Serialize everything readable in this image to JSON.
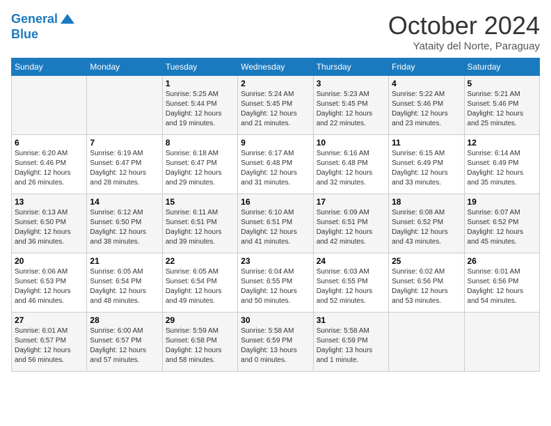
{
  "header": {
    "logo_line1": "General",
    "logo_line2": "Blue",
    "month_year": "October 2024",
    "location": "Yataity del Norte, Paraguay"
  },
  "weekdays": [
    "Sunday",
    "Monday",
    "Tuesday",
    "Wednesday",
    "Thursday",
    "Friday",
    "Saturday"
  ],
  "weeks": [
    [
      {
        "day": "",
        "content": ""
      },
      {
        "day": "",
        "content": ""
      },
      {
        "day": "1",
        "content": "Sunrise: 5:25 AM\nSunset: 5:44 PM\nDaylight: 12 hours\nand 19 minutes."
      },
      {
        "day": "2",
        "content": "Sunrise: 5:24 AM\nSunset: 5:45 PM\nDaylight: 12 hours\nand 21 minutes."
      },
      {
        "day": "3",
        "content": "Sunrise: 5:23 AM\nSunset: 5:45 PM\nDaylight: 12 hours\nand 22 minutes."
      },
      {
        "day": "4",
        "content": "Sunrise: 5:22 AM\nSunset: 5:46 PM\nDaylight: 12 hours\nand 23 minutes."
      },
      {
        "day": "5",
        "content": "Sunrise: 5:21 AM\nSunset: 5:46 PM\nDaylight: 12 hours\nand 25 minutes."
      }
    ],
    [
      {
        "day": "6",
        "content": "Sunrise: 6:20 AM\nSunset: 6:46 PM\nDaylight: 12 hours\nand 26 minutes."
      },
      {
        "day": "7",
        "content": "Sunrise: 6:19 AM\nSunset: 6:47 PM\nDaylight: 12 hours\nand 28 minutes."
      },
      {
        "day": "8",
        "content": "Sunrise: 6:18 AM\nSunset: 6:47 PM\nDaylight: 12 hours\nand 29 minutes."
      },
      {
        "day": "9",
        "content": "Sunrise: 6:17 AM\nSunset: 6:48 PM\nDaylight: 12 hours\nand 31 minutes."
      },
      {
        "day": "10",
        "content": "Sunrise: 6:16 AM\nSunset: 6:48 PM\nDaylight: 12 hours\nand 32 minutes."
      },
      {
        "day": "11",
        "content": "Sunrise: 6:15 AM\nSunset: 6:49 PM\nDaylight: 12 hours\nand 33 minutes."
      },
      {
        "day": "12",
        "content": "Sunrise: 6:14 AM\nSunset: 6:49 PM\nDaylight: 12 hours\nand 35 minutes."
      }
    ],
    [
      {
        "day": "13",
        "content": "Sunrise: 6:13 AM\nSunset: 6:50 PM\nDaylight: 12 hours\nand 36 minutes."
      },
      {
        "day": "14",
        "content": "Sunrise: 6:12 AM\nSunset: 6:50 PM\nDaylight: 12 hours\nand 38 minutes."
      },
      {
        "day": "15",
        "content": "Sunrise: 6:11 AM\nSunset: 6:51 PM\nDaylight: 12 hours\nand 39 minutes."
      },
      {
        "day": "16",
        "content": "Sunrise: 6:10 AM\nSunset: 6:51 PM\nDaylight: 12 hours\nand 41 minutes."
      },
      {
        "day": "17",
        "content": "Sunrise: 6:09 AM\nSunset: 6:51 PM\nDaylight: 12 hours\nand 42 minutes."
      },
      {
        "day": "18",
        "content": "Sunrise: 6:08 AM\nSunset: 6:52 PM\nDaylight: 12 hours\nand 43 minutes."
      },
      {
        "day": "19",
        "content": "Sunrise: 6:07 AM\nSunset: 6:52 PM\nDaylight: 12 hours\nand 45 minutes."
      }
    ],
    [
      {
        "day": "20",
        "content": "Sunrise: 6:06 AM\nSunset: 6:53 PM\nDaylight: 12 hours\nand 46 minutes."
      },
      {
        "day": "21",
        "content": "Sunrise: 6:05 AM\nSunset: 6:54 PM\nDaylight: 12 hours\nand 48 minutes."
      },
      {
        "day": "22",
        "content": "Sunrise: 6:05 AM\nSunset: 6:54 PM\nDaylight: 12 hours\nand 49 minutes."
      },
      {
        "day": "23",
        "content": "Sunrise: 6:04 AM\nSunset: 6:55 PM\nDaylight: 12 hours\nand 50 minutes."
      },
      {
        "day": "24",
        "content": "Sunrise: 6:03 AM\nSunset: 6:55 PM\nDaylight: 12 hours\nand 52 minutes."
      },
      {
        "day": "25",
        "content": "Sunrise: 6:02 AM\nSunset: 6:56 PM\nDaylight: 12 hours\nand 53 minutes."
      },
      {
        "day": "26",
        "content": "Sunrise: 6:01 AM\nSunset: 6:56 PM\nDaylight: 12 hours\nand 54 minutes."
      }
    ],
    [
      {
        "day": "27",
        "content": "Sunrise: 6:01 AM\nSunset: 6:57 PM\nDaylight: 12 hours\nand 56 minutes."
      },
      {
        "day": "28",
        "content": "Sunrise: 6:00 AM\nSunset: 6:57 PM\nDaylight: 12 hours\nand 57 minutes."
      },
      {
        "day": "29",
        "content": "Sunrise: 5:59 AM\nSunset: 6:58 PM\nDaylight: 12 hours\nand 58 minutes."
      },
      {
        "day": "30",
        "content": "Sunrise: 5:58 AM\nSunset: 6:59 PM\nDaylight: 13 hours\nand 0 minutes."
      },
      {
        "day": "31",
        "content": "Sunrise: 5:58 AM\nSunset: 6:59 PM\nDaylight: 13 hours\nand 1 minute."
      },
      {
        "day": "",
        "content": ""
      },
      {
        "day": "",
        "content": ""
      }
    ]
  ]
}
